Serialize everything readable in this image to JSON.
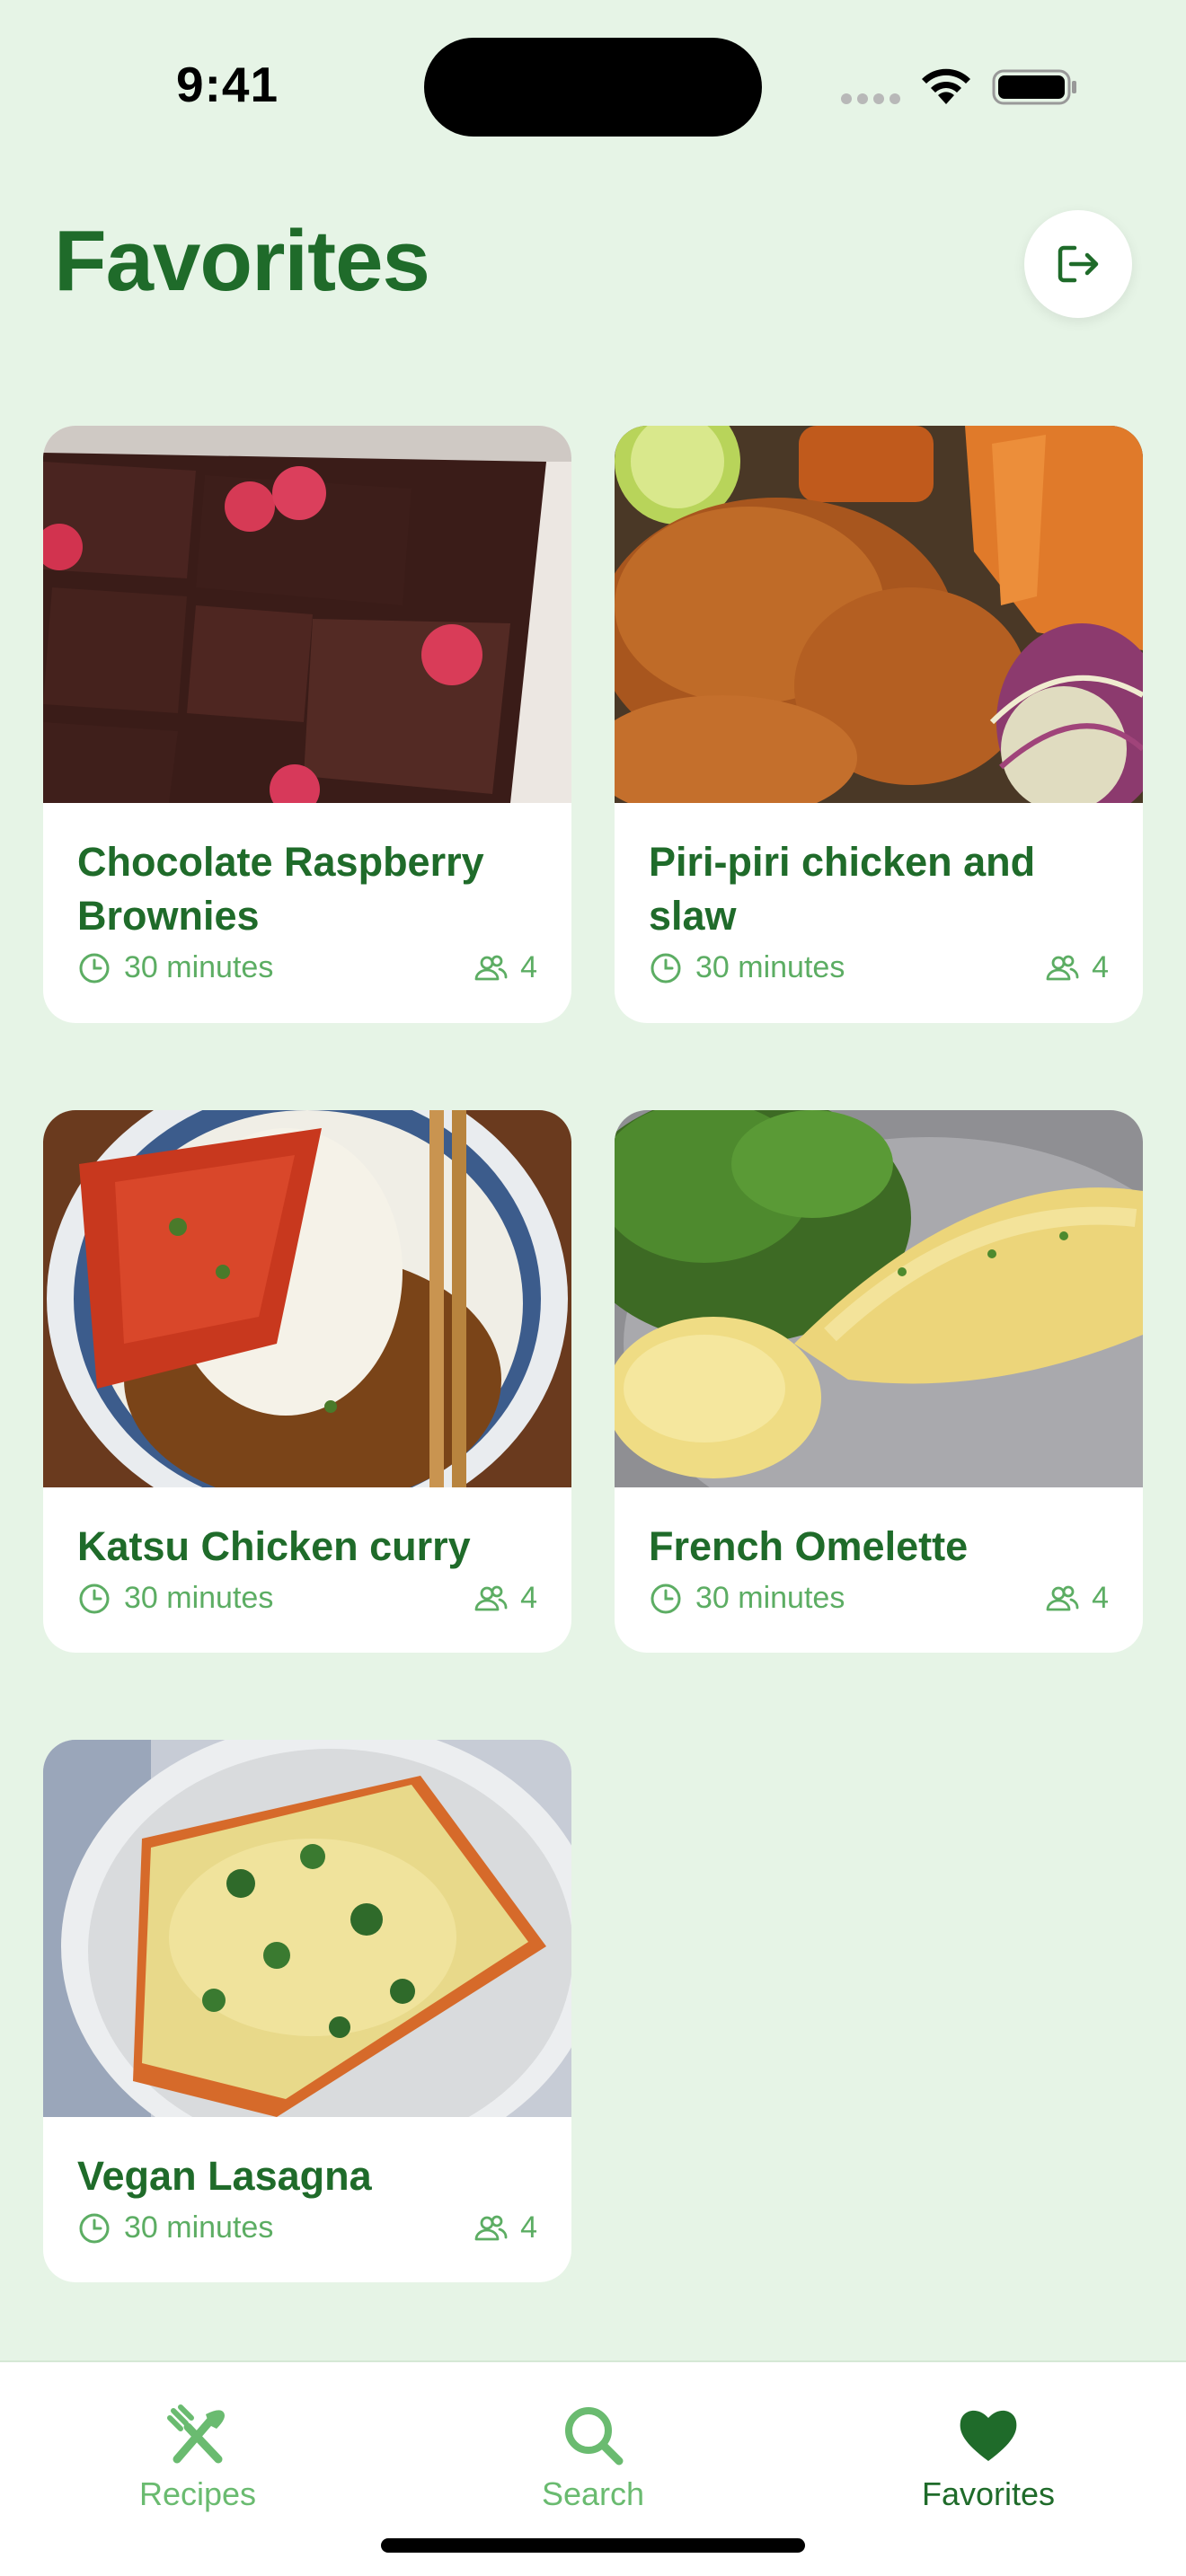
{
  "status_bar": {
    "time": "9:41"
  },
  "header": {
    "title": "Favorites",
    "logout_icon": "logout-icon"
  },
  "recipes": [
    {
      "title": "Chocolate Raspberry Brownies",
      "time": "30 minutes",
      "servings": "4",
      "image": "brownies-photo"
    },
    {
      "title": "Piri-piri chicken and slaw",
      "time": "30 minutes",
      "servings": "4",
      "image": "piri-piri-chicken-photo"
    },
    {
      "title": "Katsu Chicken curry",
      "time": "30 minutes",
      "servings": "4",
      "image": "katsu-curry-photo"
    },
    {
      "title": "French Omelette",
      "time": "30 minutes",
      "servings": "4",
      "image": "omelette-photo"
    },
    {
      "title": "Vegan Lasagna",
      "time": "30 minutes",
      "servings": "4",
      "image": "lasagna-photo"
    }
  ],
  "tabs": [
    {
      "label": "Recipes",
      "icon": "fork-knife-icon",
      "active": false
    },
    {
      "label": "Search",
      "icon": "search-icon",
      "active": false
    },
    {
      "label": "Favorites",
      "icon": "heart-icon",
      "active": true
    }
  ],
  "colors": {
    "background": "#e6f4e6",
    "primary": "#1f6b2a",
    "accent": "#5cad63",
    "card": "#ffffff"
  }
}
